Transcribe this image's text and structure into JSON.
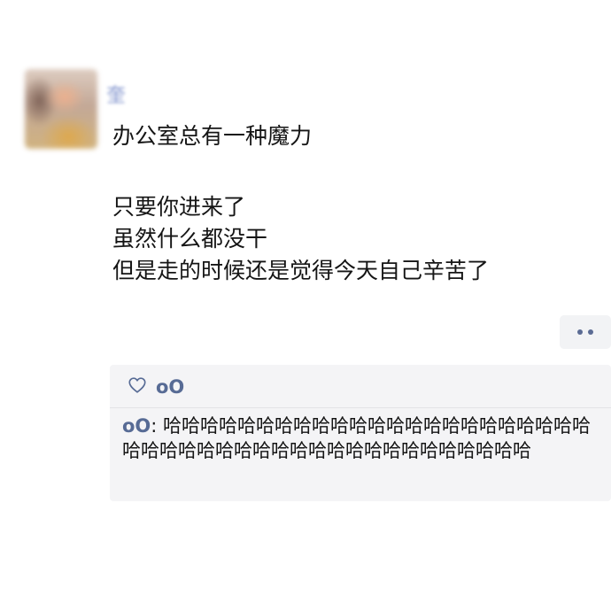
{
  "post": {
    "author": {
      "avatar_icon": "blurred-avatar",
      "nickname": "奎"
    },
    "lines": [
      "办公室总有一种魔力",
      "",
      "只要你进来了",
      "虽然什么都没干",
      "但是走的时候还是觉得今天自己辛苦了"
    ]
  },
  "actions": {
    "more_icon": "more-dots-icon"
  },
  "interactions": {
    "like_icon": "heart-outline-icon",
    "likes": [
      "oO"
    ],
    "comments": [
      {
        "author": "oO",
        "separator": ": ",
        "text": "哈哈哈哈哈哈哈哈哈哈哈哈哈哈哈哈哈哈哈哈哈哈哈哈哈哈哈哈哈哈哈哈哈哈哈哈哈哈哈哈哈哈哈哈哈"
      }
    ]
  },
  "colors": {
    "link": "#576b95",
    "box_bg": "#f4f4f6",
    "text": "#151515"
  }
}
